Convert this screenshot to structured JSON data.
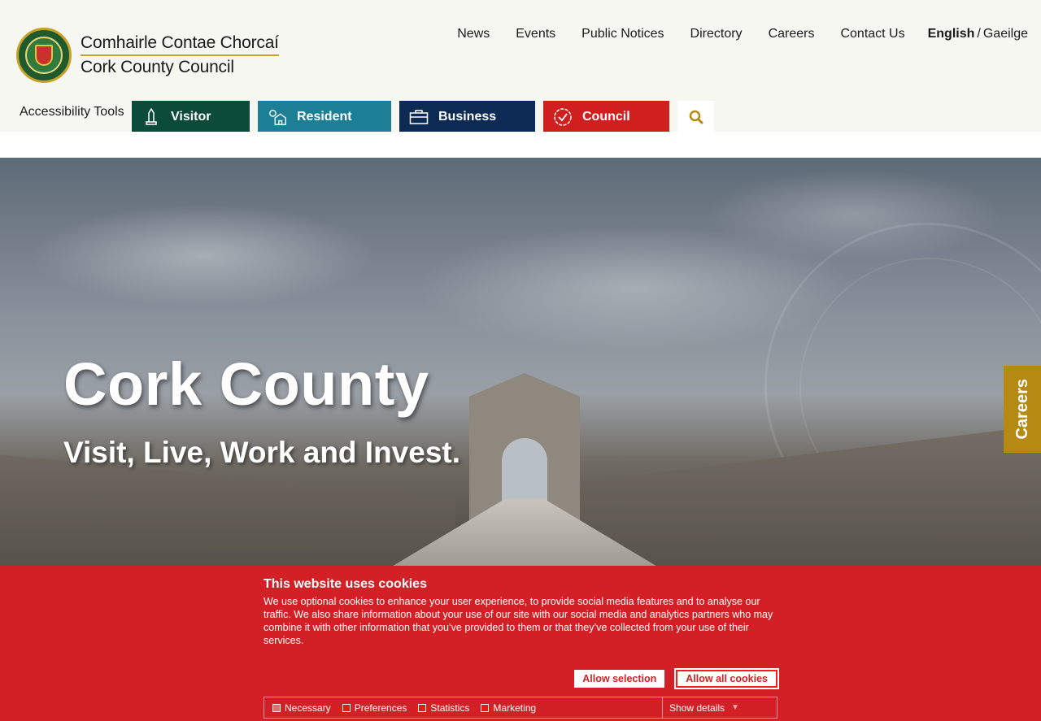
{
  "header": {
    "logo_line1": "Comhairle Contae Chorcaí",
    "logo_line2": "Cork County Council",
    "topnav": [
      "News",
      "Events",
      "Public Notices",
      "Directory",
      "Careers",
      "Contact Us"
    ],
    "lang_english": "English",
    "lang_sep": "/",
    "lang_irish": "Gaeilge",
    "accessibility": "Accessibility Tools",
    "mainnav": {
      "visitor": "Visitor",
      "resident": "Resident",
      "business": "Business",
      "council": "Council"
    },
    "search_icon": "search-icon"
  },
  "hero": {
    "title": "Cork County",
    "tagline": "Visit, Live, Work and Invest."
  },
  "side_tab": "Careers",
  "cookie": {
    "title": "This website uses cookies",
    "text": "We use optional cookies to enhance your user experience, to provide social media features and to analyse our traffic. We also share information about your use of our site with our social media and analytics partners who may combine it with other information that you’ve provided to them or that they’ve collected from your use of their services.",
    "allow_selection": "Allow selection",
    "allow_all": "Allow all cookies",
    "checks": [
      {
        "label": "Necessary",
        "checked": true
      },
      {
        "label": "Preferences",
        "checked": false
      },
      {
        "label": "Statistics",
        "checked": false
      },
      {
        "label": "Marketing",
        "checked": false
      }
    ],
    "show_details": "Show details"
  },
  "colors": {
    "visitor": "#0c4a3a",
    "resident": "#1d7f96",
    "business": "#0d2a55",
    "council": "#d01f1f",
    "cookie_bg": "#d32026",
    "gold": "#b58a12"
  }
}
